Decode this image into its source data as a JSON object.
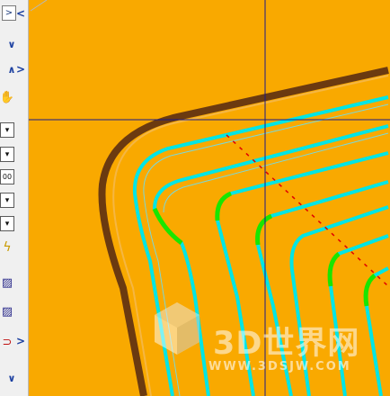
{
  "toolbar": {
    "buttons": [
      {
        "name": "close-icon",
        "glyph": ">"
      },
      {
        "name": "collapse-down-icon",
        "glyph": "∨"
      },
      {
        "name": "collapse-up-icon",
        "glyph": "∧"
      },
      {
        "name": "pan-icon",
        "glyph": "✋"
      },
      {
        "name": "dropdown-1",
        "glyph": "▾"
      },
      {
        "name": "dropdown-2",
        "glyph": "▾"
      },
      {
        "name": "dropdown-3",
        "glyph": "00"
      },
      {
        "name": "dropdown-4",
        "glyph": "▾"
      },
      {
        "name": "dropdown-5",
        "glyph": "▾"
      },
      {
        "name": "lightning-icon",
        "glyph": "ϟ"
      },
      {
        "name": "hatch-icon",
        "glyph": "▨"
      },
      {
        "name": "hatch-alt-icon",
        "glyph": "▨"
      },
      {
        "name": "magnet-icon",
        "glyph": "⊃"
      },
      {
        "name": "expand-down-icon",
        "glyph": "∨"
      }
    ]
  },
  "nav": {
    "left_arrow": "<",
    "right_arrow": ">",
    "right_arrow_bottom": ">"
  },
  "watermark": {
    "title": "3D世界网",
    "url": "WWW.3DSJW.COM"
  },
  "colors": {
    "background": "#f9a900",
    "toolpath_primary": "#00e5e5",
    "toolpath_secondary": "#19e600",
    "wall": "#6b3a10",
    "cursor": "#1a1a8a",
    "leadin": "#e00000"
  }
}
